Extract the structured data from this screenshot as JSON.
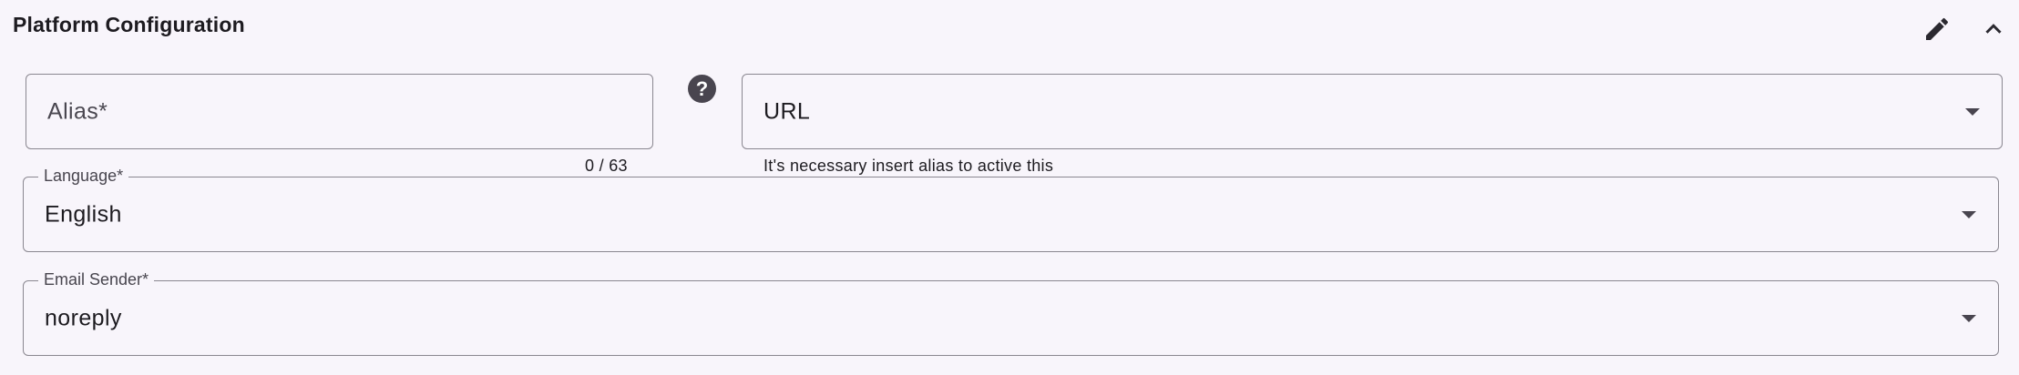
{
  "section": {
    "title": "Platform Configuration",
    "icons": {
      "edit": "pencil-icon",
      "collapse": "chevron-up-icon"
    }
  },
  "alias": {
    "label": "Alias*",
    "value": "",
    "counter": "0 / 63"
  },
  "help": {
    "glyph": "?",
    "icon": "help-circle-icon"
  },
  "url": {
    "label": "URL",
    "helper": "It's necessary insert alias to active this"
  },
  "language": {
    "label": "Language*",
    "value": "English"
  },
  "email_sender": {
    "label": "Email Sender*",
    "value": "noreply"
  },
  "colors": {
    "background": "#f8f5fb",
    "border": "#8a8790",
    "icon": "#49454f",
    "text": "#1d1b20"
  }
}
